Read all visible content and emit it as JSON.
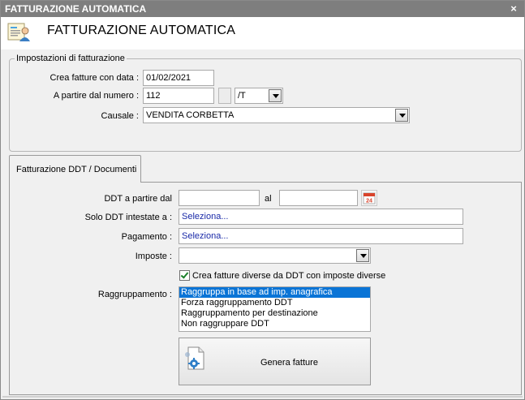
{
  "window": {
    "title": "FATTURAZIONE AUTOMATICA",
    "close_glyph": "×"
  },
  "header": {
    "title": "FATTURAZIONE AUTOMATICA",
    "icon": "invoice-person-icon"
  },
  "settings": {
    "legend": "Impostazioni di fatturazione",
    "date_label": "Crea fatture con data :",
    "date_value": "01/02/2021",
    "number_label": "A partire dal numero :",
    "number_value": "112",
    "series_value": "/T",
    "causale_label": "Causale :",
    "causale_value": "VENDITA CORBETTA"
  },
  "tabs": [
    {
      "label": "Fatturazione DDT / Documenti",
      "active": true
    }
  ],
  "ddt": {
    "from_label": "DDT a partire dal",
    "from_value": "",
    "to_label": "al",
    "to_value": "",
    "calendar_icon": "calendar-icon",
    "calendar_day": "24",
    "solo_label": "Solo DDT intestate a :",
    "solo_value": "Seleziona...",
    "pagamento_label": "Pagamento :",
    "pagamento_value": "Seleziona...",
    "imposte_label": "Imposte :",
    "imposte_value": "",
    "checkbox_label": "Crea fatture diverse da DDT con imposte diverse",
    "checkbox_checked": true,
    "grouping_label": "Raggruppamento :",
    "grouping_options": [
      "Raggruppa in base ad imp. anagrafica",
      "Forza raggruppamento DDT",
      "Raggruppamento per destinazione",
      "Non raggruppare DDT"
    ],
    "grouping_selected": 0,
    "generate_label": "Genera fatture",
    "generate_icon": "document-gear-icon"
  },
  "colors": {
    "titlebar": "#7e7e7e",
    "selection": "#0a74d6",
    "link_text": "#1a2aa8",
    "check": "#1b7f2a",
    "calendar_red": "#d9432b"
  }
}
